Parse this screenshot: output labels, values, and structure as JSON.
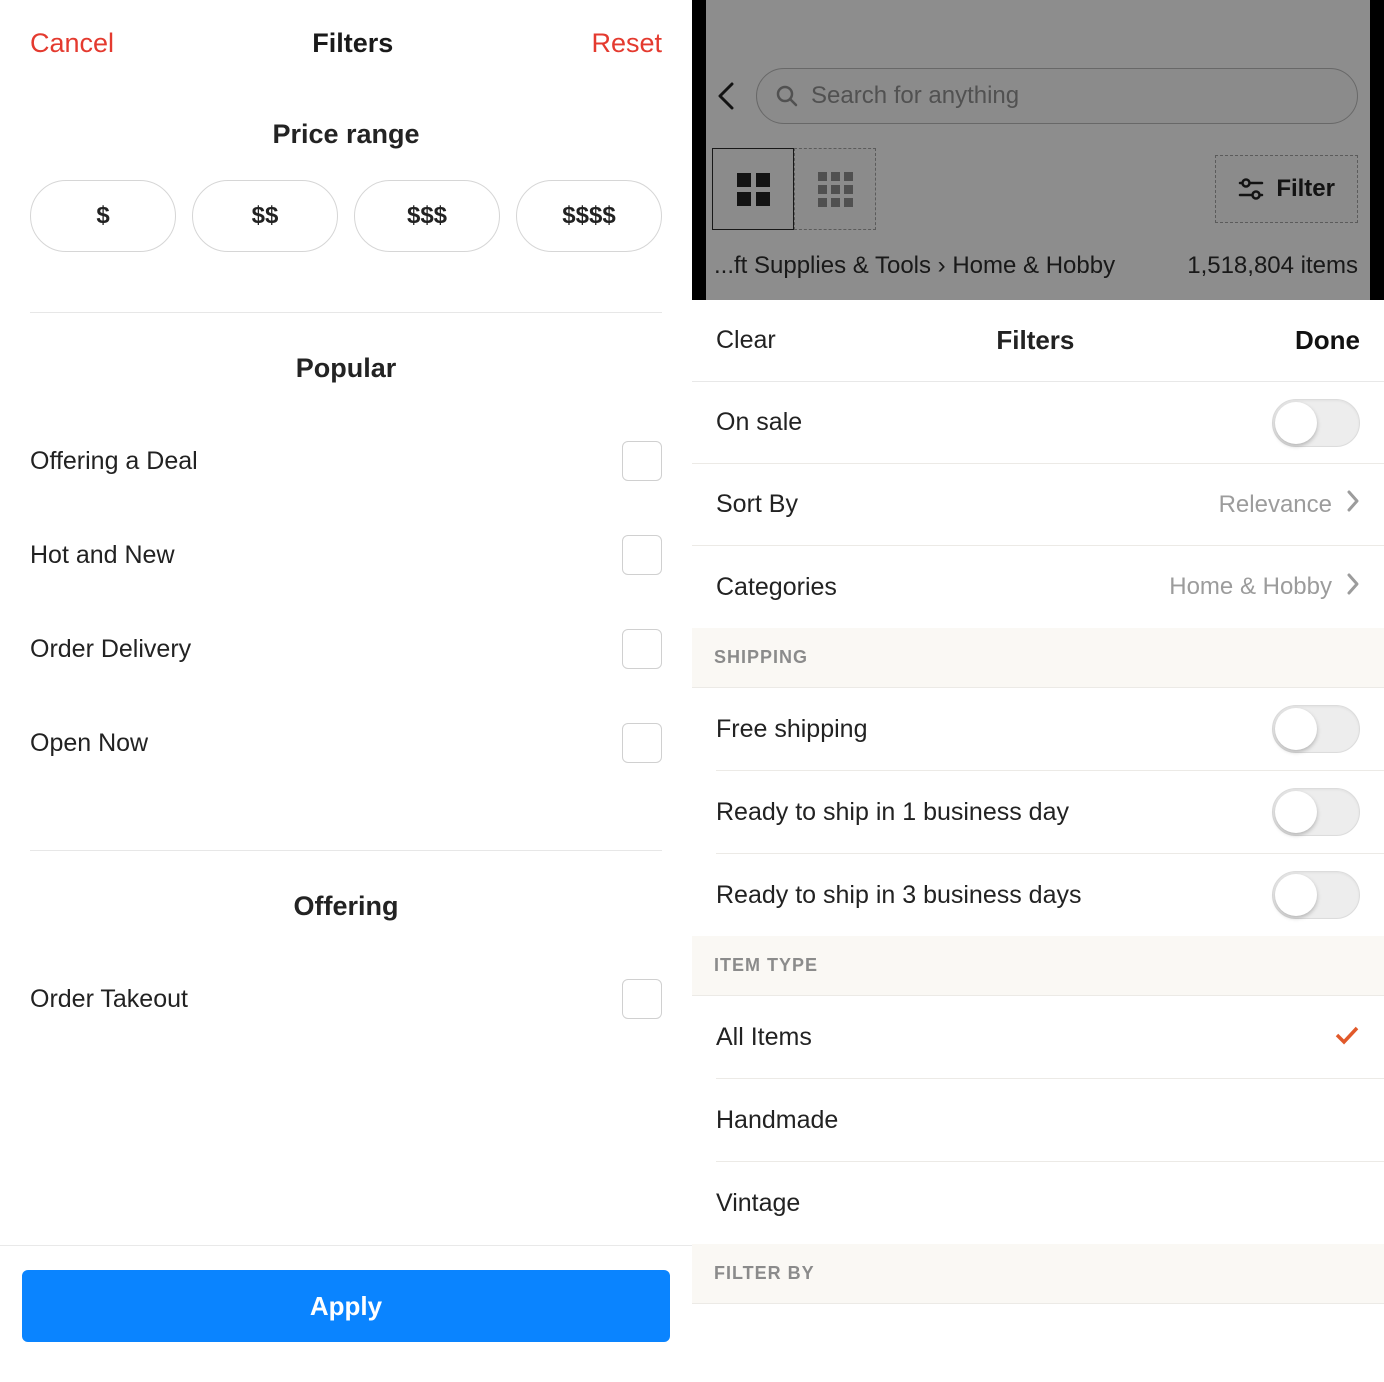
{
  "left": {
    "header": {
      "cancel": "Cancel",
      "title": "Filters",
      "reset": "Reset"
    },
    "price": {
      "title": "Price range",
      "options": [
        "$",
        "$$",
        "$$$",
        "$$$$"
      ]
    },
    "popular": {
      "title": "Popular",
      "items": [
        {
          "label": "Offering a Deal"
        },
        {
          "label": "Hot and New"
        },
        {
          "label": "Order Delivery"
        },
        {
          "label": "Open Now"
        }
      ]
    },
    "offering": {
      "title": "Offering",
      "items": [
        {
          "label": "Order Takeout"
        }
      ]
    },
    "apply": "Apply"
  },
  "right": {
    "search": {
      "placeholder": "Search for anything"
    },
    "toolbar": {
      "filter_label": "Filter"
    },
    "breadcrumb": {
      "path": "...ft Supplies & Tools › Home & Hobby",
      "count": "1,518,804 items"
    },
    "sheet_header": {
      "clear": "Clear",
      "title": "Filters",
      "done": "Done"
    },
    "top_rows": {
      "on_sale": "On sale",
      "sort_by": {
        "label": "Sort By",
        "value": "Relevance"
      },
      "categories": {
        "label": "Categories",
        "value": "Home & Hobby"
      }
    },
    "shipping": {
      "heading": "SHIPPING",
      "items": [
        {
          "label": "Free shipping"
        },
        {
          "label": "Ready to ship in 1 business day"
        },
        {
          "label": "Ready to ship in 3 business days"
        }
      ]
    },
    "item_type": {
      "heading": "ITEM TYPE",
      "items": [
        {
          "label": "All Items",
          "selected": true
        },
        {
          "label": "Handmade"
        },
        {
          "label": "Vintage"
        }
      ]
    },
    "filter_by": {
      "heading": "FILTER BY"
    }
  }
}
